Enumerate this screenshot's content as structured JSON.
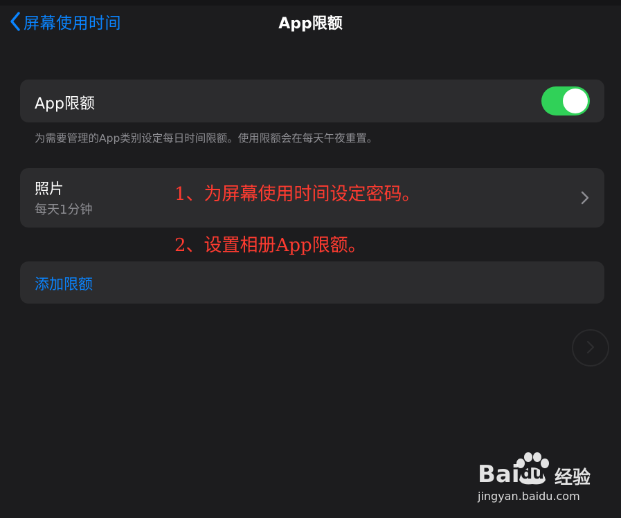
{
  "nav": {
    "back_label": "屏幕使用时间",
    "title": "App限额"
  },
  "toggle_row": {
    "label": "App限额",
    "enabled": true
  },
  "footer_note": "为需要管理的App类别设定每日时间限额。使用限额会在每天午夜重置。",
  "limits": [
    {
      "title": "照片",
      "subtitle": "每天1分钟"
    }
  ],
  "add_limit_label": "添加限额",
  "annotations": [
    "1、为屏幕使用时间设定密码。",
    "2、设置相册App限额。"
  ],
  "watermark": {
    "brand": "Bai",
    "brand_du": "du",
    "brand_suffix": "经验",
    "url": "jingyan.baidu.com"
  },
  "colors": {
    "accent": "#0a84ff",
    "switch_on": "#30d158",
    "annotation": "#ff3b30",
    "background": "#1c1c1e",
    "card": "#2c2c2e"
  }
}
